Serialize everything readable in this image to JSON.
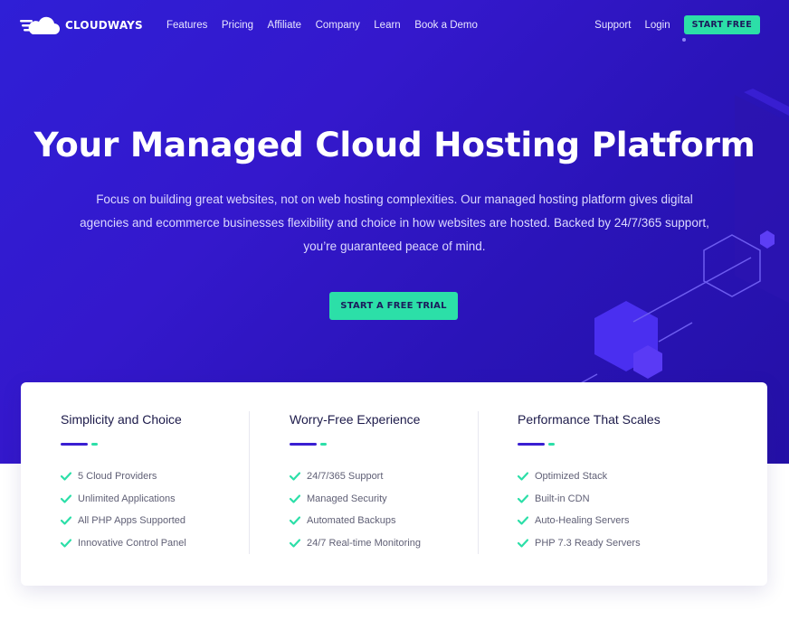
{
  "brand": {
    "name": "CLOUDWAYS"
  },
  "nav": {
    "links": [
      "Features",
      "Pricing",
      "Affiliate",
      "Company",
      "Learn",
      "Book a Demo"
    ],
    "support": "Support",
    "login": "Login",
    "start_free": "START FREE"
  },
  "hero": {
    "title": "Your Managed Cloud Hosting Platform",
    "subtitle": "Focus on building great websites, not on web hosting complexities. Our managed hosting platform gives digital agencies and ecommerce businesses flexibility and choice in how websites are hosted. Backed by 24/7/365 support, you’re guaranteed peace of mind.",
    "cta": "START A FREE TRIAL"
  },
  "features": [
    {
      "title": "Simplicity and Choice",
      "items": [
        "5 Cloud Providers",
        "Unlimited Applications",
        "All PHP Apps Supported",
        "Innovative Control Panel"
      ]
    },
    {
      "title": "Worry-Free Experience",
      "items": [
        "24/7/365 Support",
        "Managed Security",
        "Automated Backups",
        "24/7 Real-time Monitoring"
      ]
    },
    {
      "title": "Performance That Scales",
      "items": [
        "Optimized Stack",
        "Built-in CDN",
        "Auto-Healing Servers",
        "PHP 7.3 Ready Servers"
      ]
    }
  ],
  "colors": {
    "hero_bg": "#3418cc",
    "accent_green": "#2cdfa8",
    "accent_purple": "#3a1fd2",
    "text_dark": "#1c1a4a"
  },
  "icons": {
    "check": "check-icon",
    "logo": "cloud-logo-icon"
  }
}
